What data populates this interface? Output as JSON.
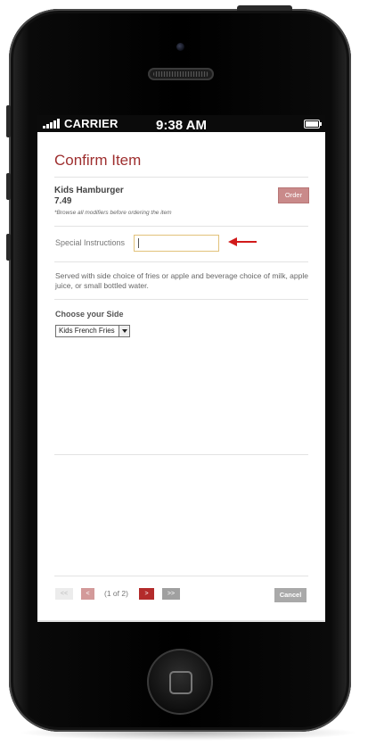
{
  "status_bar": {
    "carrier": "CARRIER",
    "time": "9:38 AM"
  },
  "page": {
    "title": "Confirm Item"
  },
  "item": {
    "name": "Kids Hamburger",
    "price": "7.49",
    "note": "*Browse all modifiers before ordering the item",
    "order_label": "Order"
  },
  "special_instructions": {
    "label": "Special Instructions",
    "value": "",
    "arrow_color": "#d11a1a"
  },
  "description": "Served with side choice of fries or apple and beverage choice of milk, apple juice, or small bottled water.",
  "side": {
    "label": "Choose your Side",
    "selected": "Kids French Fries"
  },
  "pagination": {
    "first_label": "<<",
    "prev_label": "<",
    "info": "(1 of 2)",
    "next_label": ">",
    "last_label": ">>"
  },
  "cancel_label": "Cancel",
  "colors": {
    "accent": "#9e2f2f",
    "order_button": "#c98a8a",
    "next_button": "#b32b2b",
    "input_border": "#e2c27a"
  }
}
